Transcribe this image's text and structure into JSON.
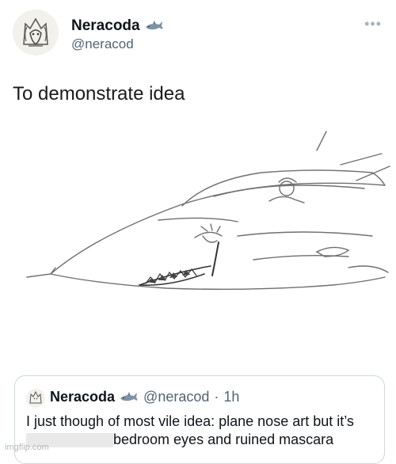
{
  "post": {
    "display_name": "Neracoda",
    "handle": "@neracod",
    "badge_icon": "shark-emoji-icon",
    "more_icon": "more-options-icon",
    "text": "To demonstrate idea"
  },
  "media": {
    "icon": "jet-nose-art-sketch"
  },
  "quote": {
    "display_name": "Neracoda",
    "handle": "@neracod",
    "separator": "·",
    "time": "1h",
    "line1": "I just though of most vile idea: plane nose art but it’s",
    "line2": "bedroom eyes and ruined mascara"
  },
  "watermark": "imgflip.com"
}
